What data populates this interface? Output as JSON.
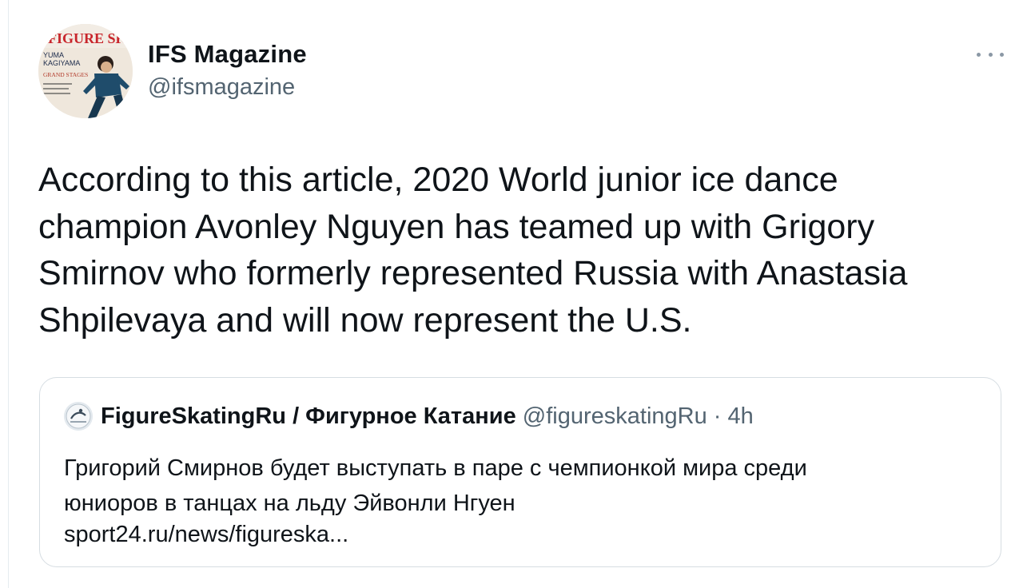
{
  "tweet": {
    "author": {
      "name": "IFS Magazine",
      "handle": "@ifsmagazine",
      "avatar_icon": "magazine-cover-avatar",
      "avatar_cover_text": {
        "masthead": "FIGURE SKATING",
        "line1": "YUMA",
        "line2": "KAGIYAMA",
        "line3": "GRAND STAGES"
      }
    },
    "more_icon": "more-options-icon",
    "text": "According to this article, 2020 World junior ice dance\nchampion Avonley Nguyen has teamed up with Grigory\nSmirnov who formerly represented Russia with Anastasia\nShpilevaya and will now represent the U.S.",
    "quote": {
      "avatar_icon": "skater-logo-avatar",
      "name": "FigureSkatingRu / Фигурное Катание",
      "handle": "@figureskatingRu",
      "separator": "·",
      "time": "4h",
      "text": "Григорий Смирнов будет выступать в паре с чемпионкой мира среди\nюниоров в танцах на льду Эйвонли Нгуен",
      "link": "sport24.ru/news/figureska..."
    }
  },
  "colors": {
    "text_primary": "#0f1419",
    "text_secondary": "#536471",
    "border": "#d6dde2"
  }
}
